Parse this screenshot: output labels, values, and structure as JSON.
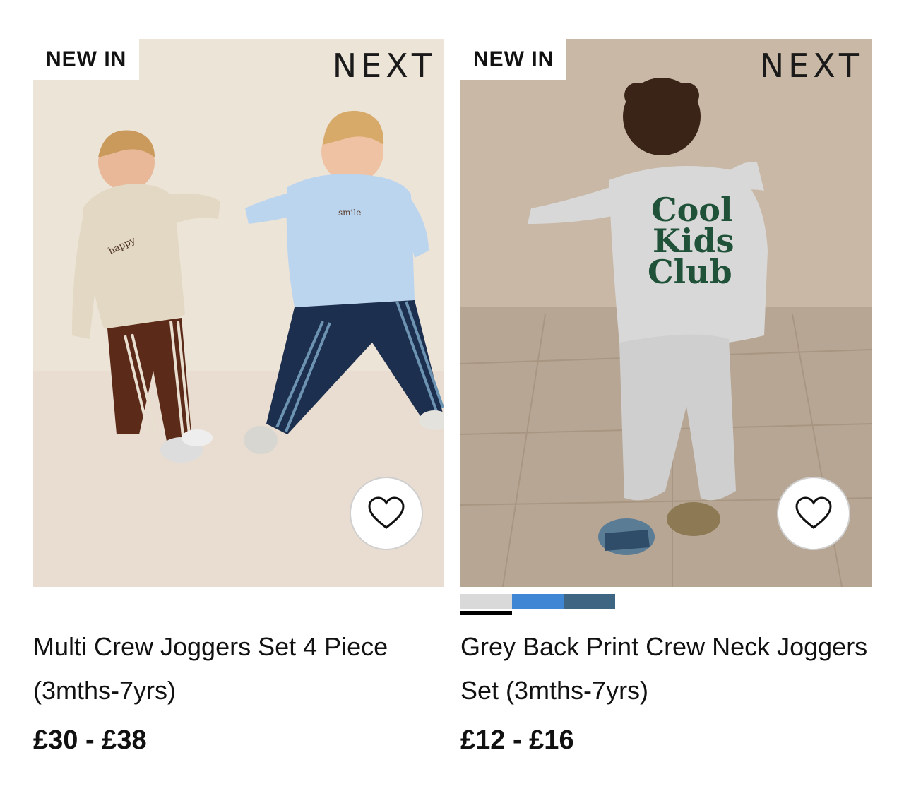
{
  "products": [
    {
      "badge": "NEW IN",
      "brand": "NEXT",
      "title": "Multi Crew Joggers Set 4 Piece (3mths-7yrs)",
      "price": "£30 - £38",
      "photo_print_left": "happy",
      "photo_print_right": "smile",
      "favourite_icon": "heart-outline-icon"
    },
    {
      "badge": "NEW IN",
      "brand": "NEXT",
      "title": "Grey Back Print Crew Neck Joggers Set (3mths-7yrs)",
      "price": "£12 - £16",
      "photo_print": "Cool Kids Club",
      "favourite_icon": "heart-outline-icon",
      "swatches": [
        {
          "color": "#d9d9d9",
          "selected": true
        },
        {
          "color": "#3f86d4",
          "selected": false
        },
        {
          "color": "#3e6682",
          "selected": false
        }
      ]
    }
  ]
}
